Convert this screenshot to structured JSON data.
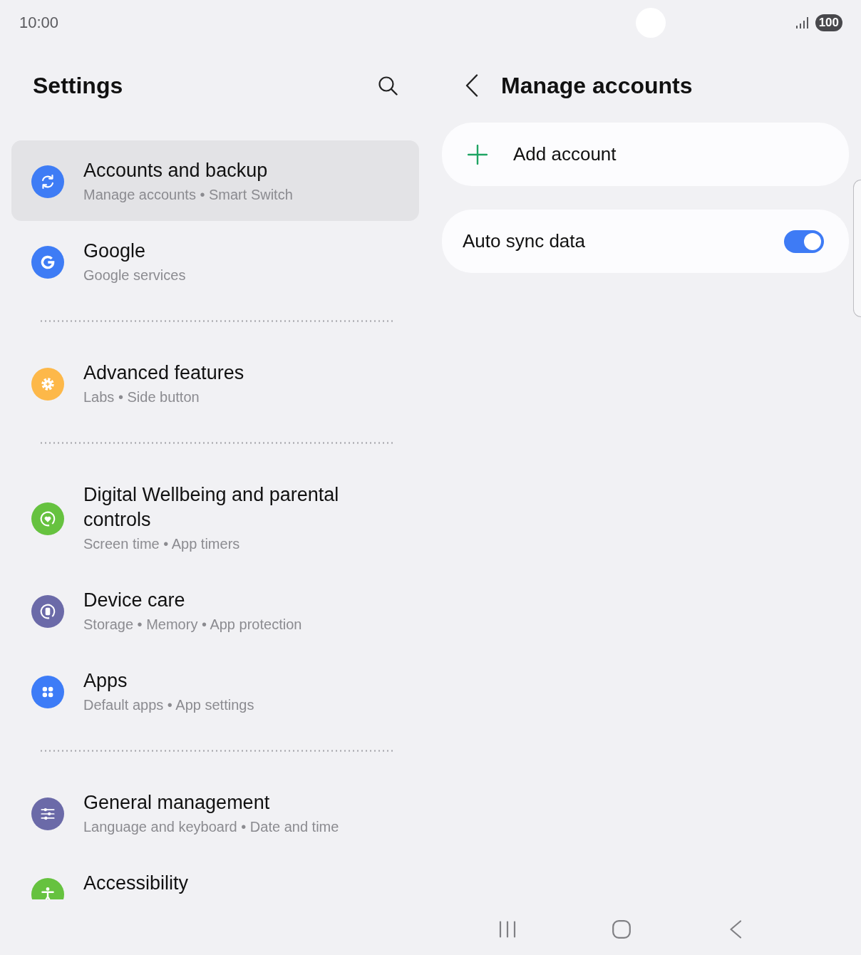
{
  "status_bar": {
    "time": "10:00",
    "battery": "100"
  },
  "settings_panel": {
    "title": "Settings",
    "groups": [
      {
        "items": [
          {
            "title": "Accounts and backup",
            "subtitle": "Manage accounts • Smart Switch",
            "color": "#3e7cf5",
            "selected": true
          },
          {
            "title": "Google",
            "subtitle": "Google services",
            "color": "#3e7cf5",
            "selected": false
          }
        ]
      },
      {
        "items": [
          {
            "title": "Advanced features",
            "subtitle": "Labs • Side button",
            "color": "#fdb849",
            "selected": false
          }
        ]
      },
      {
        "items": [
          {
            "title": "Digital Wellbeing and parental controls",
            "subtitle": "Screen time • App timers",
            "color": "#66c23f",
            "selected": false
          },
          {
            "title": "Device care",
            "subtitle": "Storage • Memory • App protection",
            "color": "#6b6aa8",
            "selected": false
          },
          {
            "title": "Apps",
            "subtitle": "Default apps • App settings",
            "color": "#3d7cf7",
            "selected": false
          }
        ]
      },
      {
        "items": [
          {
            "title": "General management",
            "subtitle": "Language and keyboard • Date and time",
            "color": "#6b6aa8",
            "selected": false
          },
          {
            "title": "Accessibility",
            "color": "#66c23f",
            "selected": false
          }
        ]
      }
    ]
  },
  "detail_panel": {
    "title": "Manage accounts",
    "add_account": {
      "label": "Add account"
    },
    "auto_sync": {
      "label": "Auto sync data",
      "on": true
    }
  }
}
